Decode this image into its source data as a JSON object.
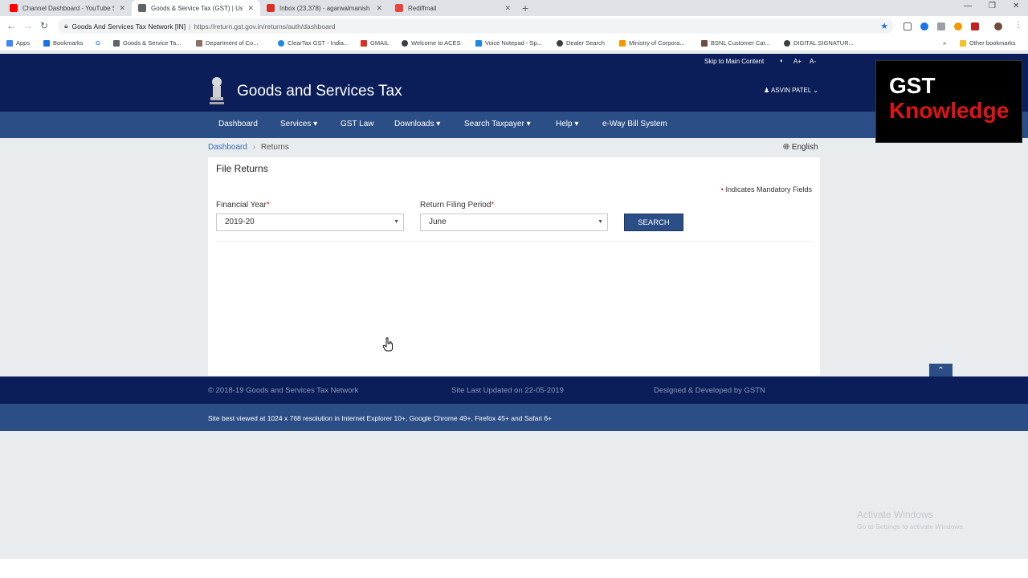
{
  "browser": {
    "tabs": [
      {
        "label": "Channel Dashboard - YouTube St",
        "favicon_color": "#ff0000"
      },
      {
        "label": "Goods & Service Tax (GST) | User",
        "favicon_color": "#5f6368"
      },
      {
        "label": "Inbox (23,378) - agarwalmanish",
        "favicon_color": "#d93025"
      },
      {
        "label": "Rediffmail",
        "favicon_color": "#e8453c"
      }
    ],
    "new_tab_glyph": "+",
    "site_name": "Goods And Services Tax Network [IN]",
    "url": "https://return.gst.gov.in/returns/auth/dashboard",
    "bookmarks": [
      "Apps",
      "Bookmarks",
      "G",
      "Goods & Service Ta...",
      "Department of Co...",
      "ClearTax GST - India...",
      "GMAIL",
      "Welcome to ACES",
      "Voice Notepad - Sp...",
      "Dealer Search",
      "Ministry of Corpora...",
      "BSNL Customer Car...",
      "DIGITAL SIGNATUR..."
    ],
    "more_bookmarks": "»",
    "other_bookmarks": "Other bookmarks"
  },
  "accessibility": {
    "skip_link": "Skip to Main Content",
    "contrast": "◐",
    "font_increase": "A+",
    "font_decrease": "A-"
  },
  "header": {
    "site_title": "Goods and Services Tax",
    "user_name": "ASVIN PATEL"
  },
  "nav": [
    {
      "label": "Dashboard",
      "dropdown": false
    },
    {
      "label": "Services",
      "dropdown": true
    },
    {
      "label": "GST Law",
      "dropdown": false
    },
    {
      "label": "Downloads",
      "dropdown": true
    },
    {
      "label": "Search Taxpayer",
      "dropdown": true
    },
    {
      "label": "Help",
      "dropdown": true
    },
    {
      "label": "e-Way Bill System",
      "dropdown": false
    }
  ],
  "breadcrumb": {
    "home": "Dashboard",
    "current": "Returns"
  },
  "language": "English",
  "form": {
    "title": "File Returns",
    "mandatory_note": "Indicates Mandatory Fields",
    "financial_year_label": "Financial Year",
    "financial_year_value": "2019-20",
    "period_label": "Return Filing Period",
    "period_value": "June",
    "search_label": "SEARCH"
  },
  "footer": {
    "copyright": "© 2018-19 Goods and Services Tax Network",
    "last_updated": "Site Last Updated on 22-05-2019",
    "designed_by": "Designed & Developed by GSTN",
    "best_viewed": "Site best viewed at 1024 x 768 resolution in Internet Explorer 10+, Google Chrome 49+, Firefox 45+ and Safari 6+"
  },
  "watermark": {
    "title": "Activate Windows",
    "subtitle": "Go to Settings to activate Windows."
  },
  "logo": {
    "line1": "GST",
    "line2": "Knowledge"
  },
  "colors": {
    "header_navy": "#0b1e59",
    "nav_blue": "#2c4e86",
    "required_red": "#d9241d",
    "link_blue": "#2f6db4"
  }
}
